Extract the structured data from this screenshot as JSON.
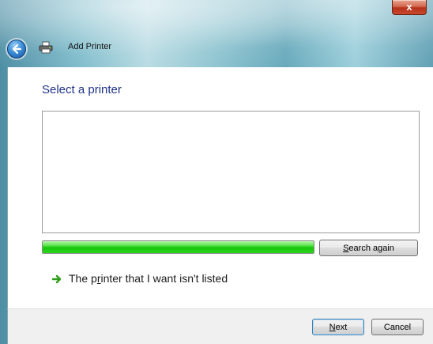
{
  "window": {
    "title": "Add Printer",
    "close_label": "x"
  },
  "icons": {
    "back": "back-arrow-icon",
    "printer": "printer-icon",
    "link_arrow": "green-arrow-icon"
  },
  "main": {
    "heading": "Select a printer",
    "printer_list_items": [],
    "search_progress": 1.0,
    "search_again_prefix": "",
    "search_again_mnemonic": "S",
    "search_again_rest": "earch again",
    "link_prefix": "The p",
    "link_mnemonic": "r",
    "link_rest": "inter that I want isn't listed"
  },
  "footer": {
    "next_mnemonic": "N",
    "next_rest": "ext",
    "cancel_label": "Cancel"
  },
  "colors": {
    "heading": "#1e3287",
    "progress": "#17c60b",
    "link_arrow": "#2e9e1a"
  }
}
